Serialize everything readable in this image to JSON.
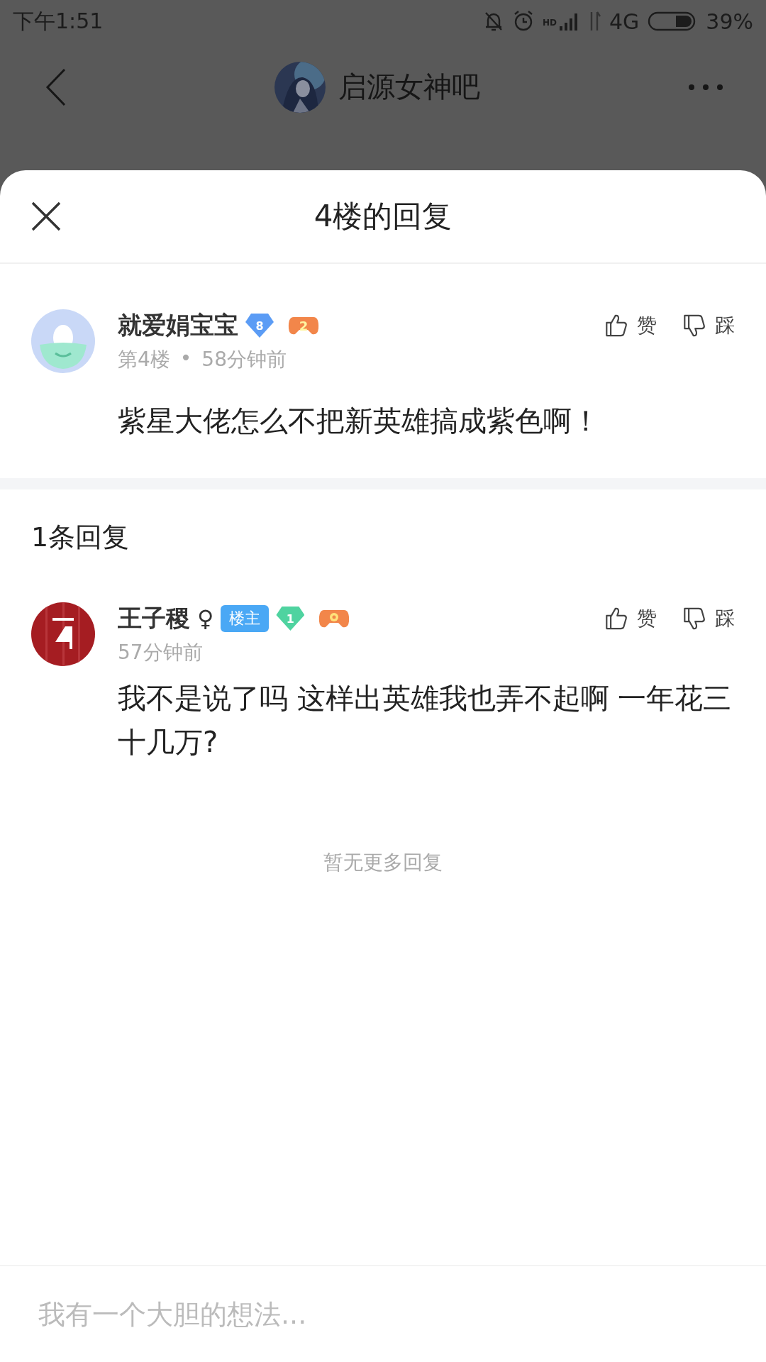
{
  "status_bar": {
    "time": "下午1:51",
    "hd": "HD",
    "network": "4G",
    "battery": "39%"
  },
  "header": {
    "title": "启源女神吧"
  },
  "sheet": {
    "title": "4楼的回复"
  },
  "post": {
    "author": "就爱娟宝宝",
    "badges": [
      {
        "kind": "level",
        "text": "8",
        "color": "#5b9cf5"
      },
      {
        "kind": "game",
        "text": "2"
      }
    ],
    "floor": "第4楼",
    "separator": "•",
    "time": "58分钟前",
    "content": "紫星大佬怎么不把新英雄搞成紫色啊！",
    "actions": [
      {
        "kind": "up",
        "label": "赞"
      },
      {
        "kind": "down",
        "label": "踩"
      }
    ]
  },
  "reply_count": "1条回复",
  "replies": [
    {
      "author": "王子稷",
      "gender": "♀",
      "badges": [
        {
          "kind": "owner",
          "text": "楼主"
        },
        {
          "kind": "level",
          "text": "1",
          "color": "#4fd3a0"
        },
        {
          "kind": "game"
        }
      ],
      "time": "57分钟前",
      "content": "我不是说了吗 这样出英雄我也弄不起啊 一年花三十几万?",
      "actions": [
        {
          "kind": "up",
          "label": "赞"
        },
        {
          "kind": "down",
          "label": "踩"
        }
      ]
    }
  ],
  "end_note": "暂无更多回复",
  "input": {
    "placeholder": "我有一个大胆的想法..."
  }
}
